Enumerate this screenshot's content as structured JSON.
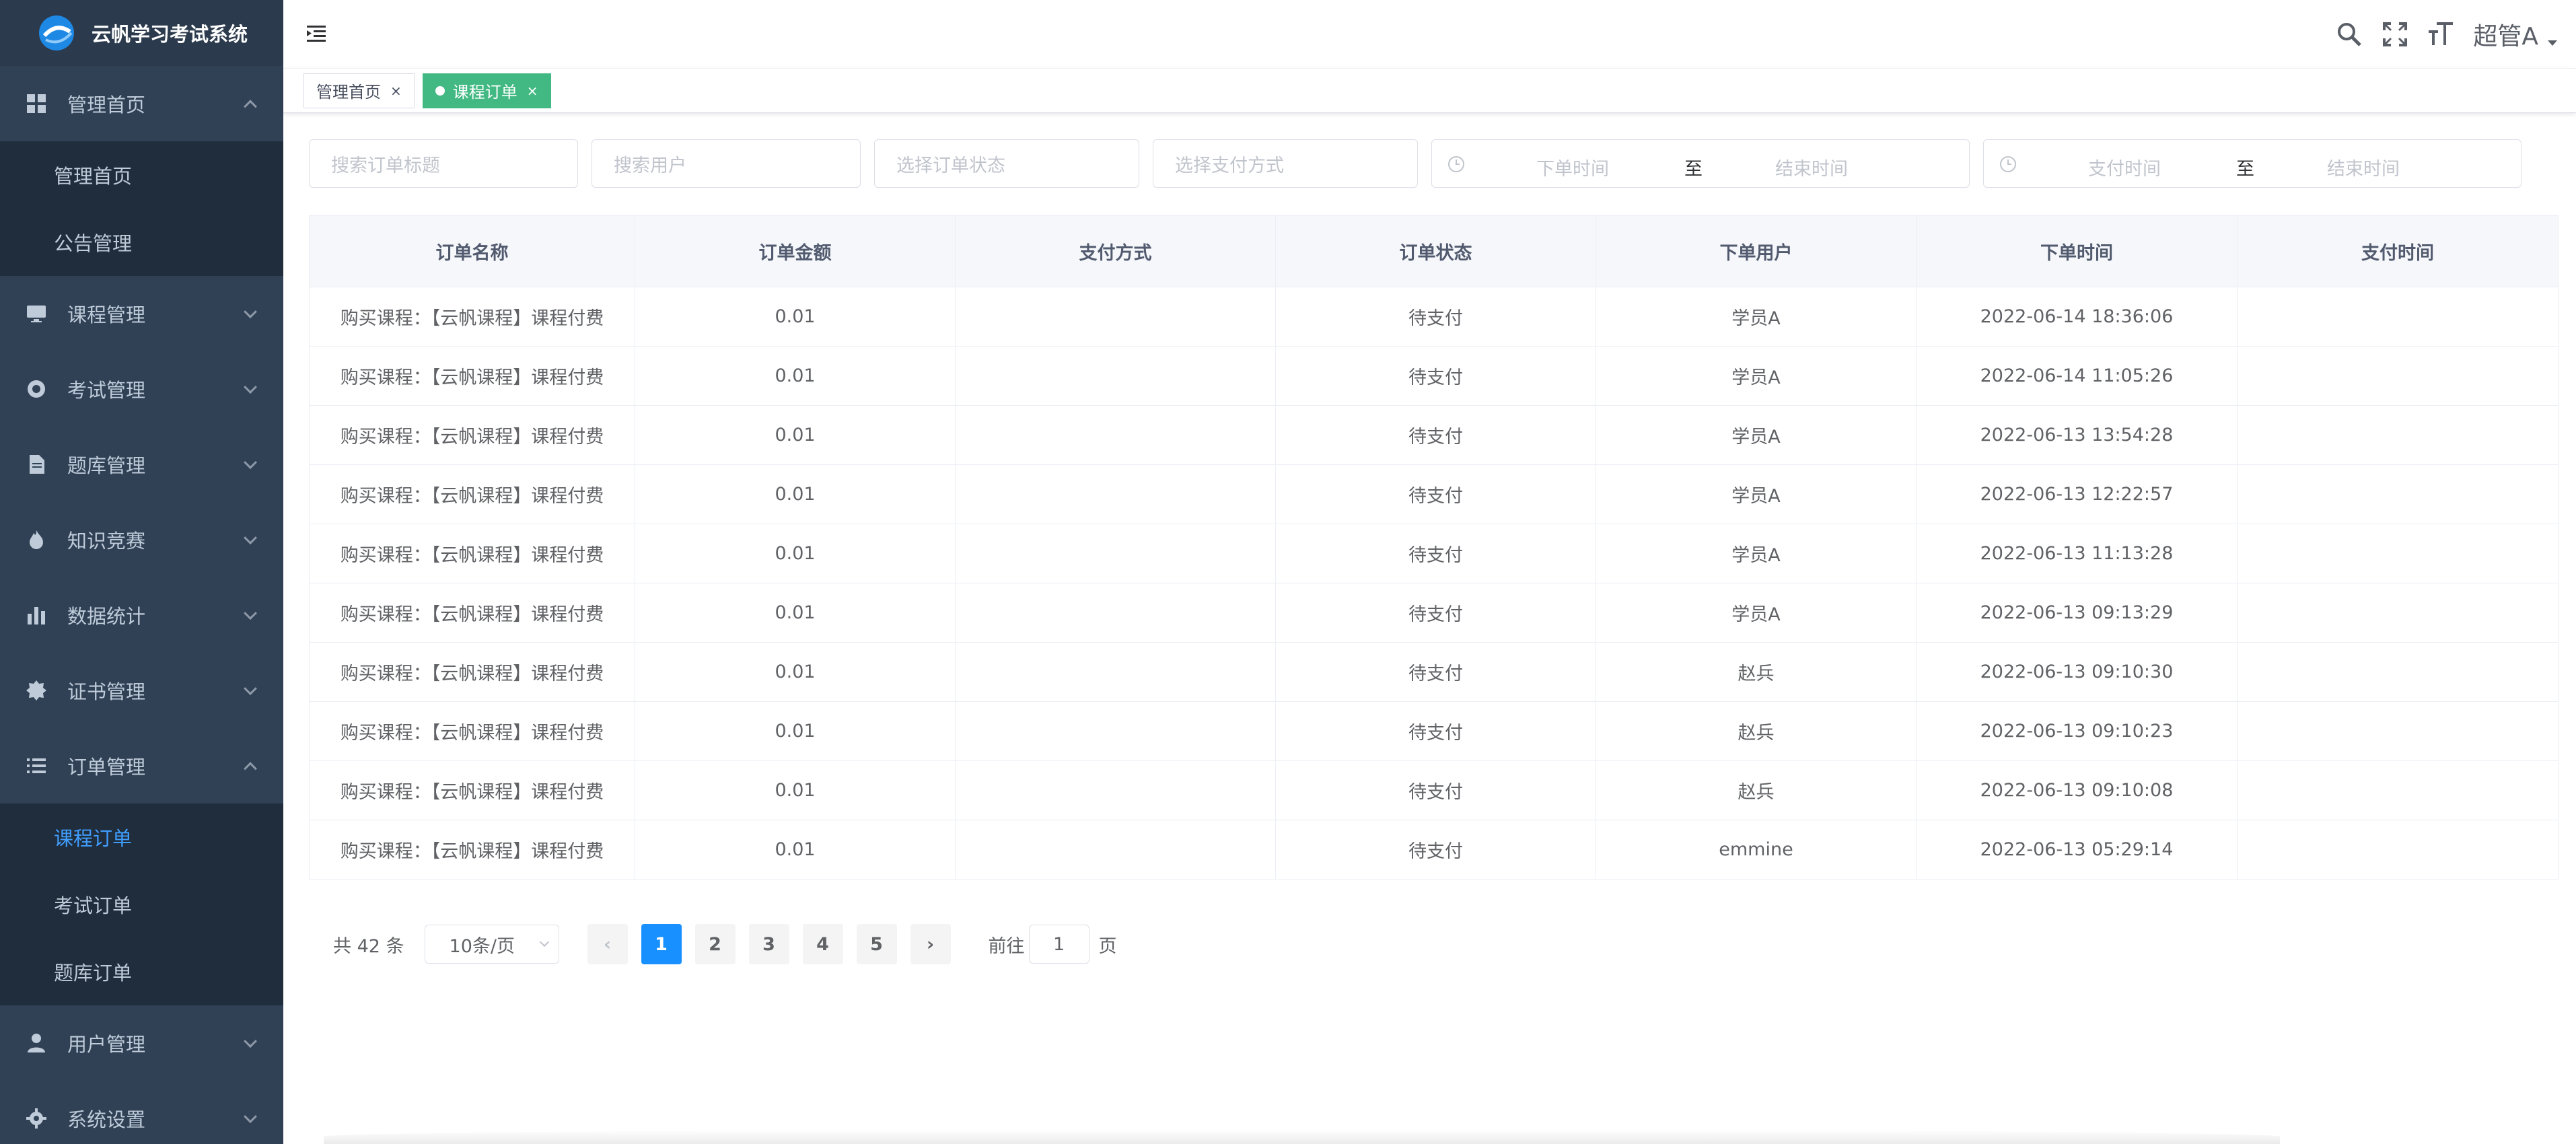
{
  "app": {
    "title": "云帆学习考试系统"
  },
  "sidebar": {
    "items": [
      {
        "label": "管理首页",
        "icon": "dashboard-icon",
        "expanded": true,
        "children": [
          {
            "label": "管理首页"
          },
          {
            "label": "公告管理"
          }
        ]
      },
      {
        "label": "课程管理",
        "icon": "monitor-icon",
        "expanded": false
      },
      {
        "label": "考试管理",
        "icon": "target-icon",
        "expanded": false
      },
      {
        "label": "题库管理",
        "icon": "document-icon",
        "expanded": false
      },
      {
        "label": "知识竞赛",
        "icon": "fire-icon",
        "expanded": false
      },
      {
        "label": "数据统计",
        "icon": "bar-chart-icon",
        "expanded": false
      },
      {
        "label": "证书管理",
        "icon": "badge-icon",
        "expanded": false
      },
      {
        "label": "订单管理",
        "icon": "list-icon",
        "expanded": true,
        "children": [
          {
            "label": "课程订单",
            "active": true
          },
          {
            "label": "考试订单"
          },
          {
            "label": "题库订单"
          }
        ]
      },
      {
        "label": "用户管理",
        "icon": "user-icon",
        "expanded": false
      },
      {
        "label": "系统设置",
        "icon": "gear-icon",
        "expanded": false
      }
    ]
  },
  "header": {
    "user_name": "超管A"
  },
  "tags": [
    {
      "label": "管理首页",
      "active": false
    },
    {
      "label": "课程订单",
      "active": true
    }
  ],
  "filters": {
    "title_placeholder": "搜索订单标题",
    "user_placeholder": "搜索用户",
    "status_placeholder": "选择订单状态",
    "payment_placeholder": "选择支付方式",
    "order_time": {
      "start": "下单时间",
      "sep": "至",
      "end": "结束时间"
    },
    "pay_time": {
      "start": "支付时间",
      "sep": "至",
      "end": "结束时间"
    }
  },
  "table": {
    "columns": [
      "订单名称",
      "订单金额",
      "支付方式",
      "订单状态",
      "下单用户",
      "下单时间",
      "支付时间"
    ],
    "rows": [
      [
        "购买课程：【云帆课程】课程付费",
        "0.01",
        "",
        "待支付",
        "学员A",
        "2022-06-14 18:36:06",
        ""
      ],
      [
        "购买课程：【云帆课程】课程付费",
        "0.01",
        "",
        "待支付",
        "学员A",
        "2022-06-14 11:05:26",
        ""
      ],
      [
        "购买课程：【云帆课程】课程付费",
        "0.01",
        "",
        "待支付",
        "学员A",
        "2022-06-13 13:54:28",
        ""
      ],
      [
        "购买课程：【云帆课程】课程付费",
        "0.01",
        "",
        "待支付",
        "学员A",
        "2022-06-13 12:22:57",
        ""
      ],
      [
        "购买课程：【云帆课程】课程付费",
        "0.01",
        "",
        "待支付",
        "学员A",
        "2022-06-13 11:13:28",
        ""
      ],
      [
        "购买课程：【云帆课程】课程付费",
        "0.01",
        "",
        "待支付",
        "学员A",
        "2022-06-13 09:13:29",
        ""
      ],
      [
        "购买课程：【云帆课程】课程付费",
        "0.01",
        "",
        "待支付",
        "赵兵",
        "2022-06-13 09:10:30",
        ""
      ],
      [
        "购买课程：【云帆课程】课程付费",
        "0.01",
        "",
        "待支付",
        "赵兵",
        "2022-06-13 09:10:23",
        ""
      ],
      [
        "购买课程：【云帆课程】课程付费",
        "0.01",
        "",
        "待支付",
        "赵兵",
        "2022-06-13 09:10:08",
        ""
      ],
      [
        "购买课程：【云帆课程】课程付费",
        "0.01",
        "",
        "待支付",
        "emmine",
        "2022-06-13 05:29:14",
        ""
      ]
    ]
  },
  "pagination": {
    "total": "共 42 条",
    "page_size": "10条/页",
    "pages": [
      "1",
      "2",
      "3",
      "4",
      "5"
    ],
    "current": "1",
    "jump_prefix": "前往",
    "jump_value": "1",
    "jump_suffix": "页"
  },
  "colors": {
    "sidebar_bg": "#304156",
    "active_tag": "#42b983",
    "primary": "#1890ff",
    "menu_active": "#409eff"
  }
}
